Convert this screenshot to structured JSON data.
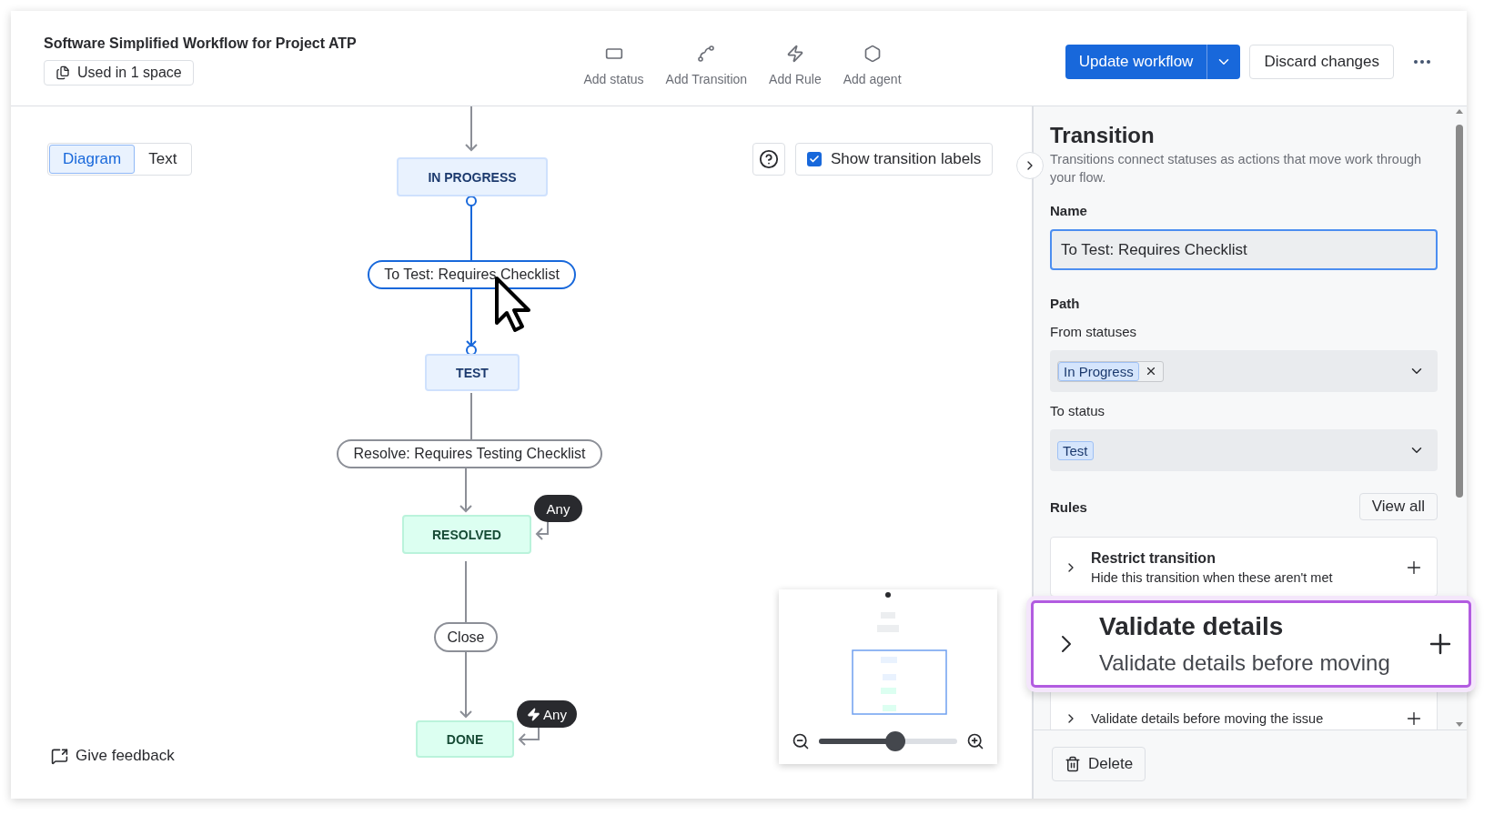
{
  "header": {
    "title": "Software Simplified Workflow for Project ATP",
    "usage": "Used in 1 space",
    "tools": [
      {
        "label": "Add status",
        "kind": "status"
      },
      {
        "label": "Add Transition",
        "kind": "transition"
      },
      {
        "label": "Add Rule",
        "kind": "rule"
      },
      {
        "label": "Add agent",
        "kind": "agent"
      }
    ],
    "primary": "Update workflow",
    "secondary": "Discard changes"
  },
  "view_toggle": [
    {
      "label": "Diagram",
      "selected": true
    },
    {
      "label": "Text",
      "selected": false
    }
  ],
  "show_labels": {
    "label": "Show transition labels",
    "checked": true
  },
  "diagram": {
    "statuses": [
      {
        "name": "IN PROGRESS",
        "color": "#e9f2fe"
      },
      {
        "name": "TEST",
        "color": "#e9f2fe"
      },
      {
        "name": "RESOLVED",
        "color": "#dcfff1"
      },
      {
        "name": "DONE",
        "color": "#dcfff1"
      }
    ],
    "transitions": [
      {
        "label": "To Test: Requires Checklist",
        "selected": true
      },
      {
        "label": "Resolve: Requires Testing Checklist",
        "selected": false
      },
      {
        "label": "Close",
        "selected": false
      }
    ],
    "global_transitions": [
      {
        "label": "Any",
        "kind": "plain"
      },
      {
        "label": "Any",
        "kind": "rule"
      }
    ]
  },
  "minimap": {
    "zoom": {
      "level": 0.55
    }
  },
  "feedback": "Give feedback",
  "panel": {
    "title": "Transition",
    "description": "Transitions connect statuses as actions that move work through your flow.",
    "name_label": "Name",
    "name_value": "To Test: Requires Checklist",
    "path_label": "Path",
    "from_label": "From statuses",
    "from_tags": [
      "In Progress"
    ],
    "to_label": "To status",
    "to_tags": [
      "Test"
    ],
    "rules_label": "Rules",
    "view_all": "View all",
    "rules": [
      {
        "title": "Restrict transition",
        "description": "Hide this transition when these aren't met"
      },
      {
        "description": "Validate details before moving the issue"
      }
    ],
    "callout": {
      "title": "Validate details",
      "description": "Validate details before moving"
    },
    "delete": "Delete"
  }
}
